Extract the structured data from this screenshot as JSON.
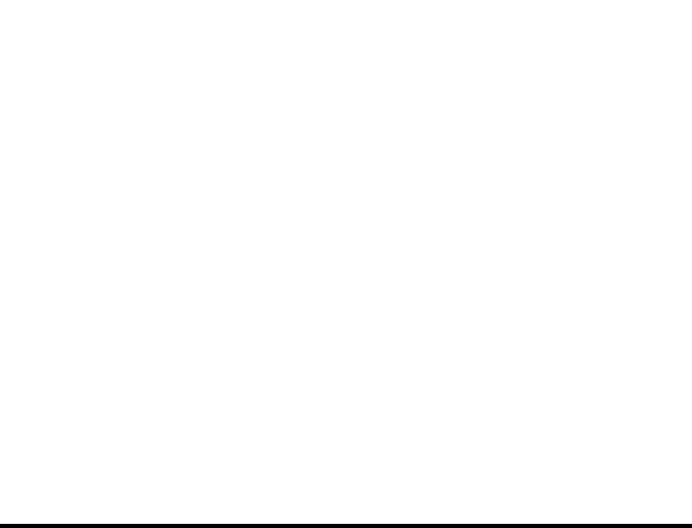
{
  "screen": {
    "background_color": "#ffffff",
    "bottom_edge_color": "#000000"
  }
}
